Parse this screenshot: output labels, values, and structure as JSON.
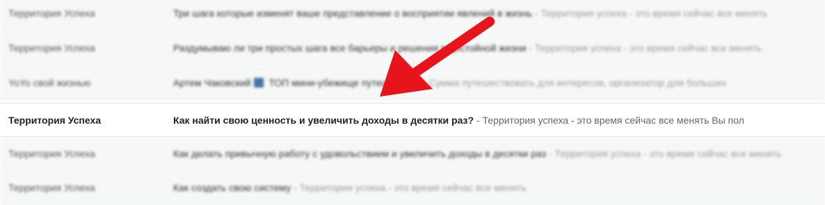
{
  "inbox": {
    "rows": [
      {
        "sender": "Территория Успеха",
        "subject": "Три шага которые изменят ваше представление о восприятии явлений в жизнь",
        "snippet": " - Территория успеха - это время сейчас все менять"
      },
      {
        "sender": "Территория Успеха",
        "subject": "Раздумываю ли три простых шага все барьеры и решения в достойной жизни",
        "snippet": " - Территория успеха - это время сейчас все менять"
      },
      {
        "sender": "YoYo свой жизнью",
        "subject": "Артем Чаковский",
        "subject_tail": " ТОП мини-убежище путешествие",
        "snippet": " - Сумма путешествовать для интересов, организатор для больших"
      },
      {
        "sender": "Территория Успеха",
        "subject": "Как найти свою ценность и увеличить доходы в десятки раз?",
        "snippet": " - Территория успеха - это время сейчас все менять Вы пол"
      },
      {
        "sender": "Территория Успеха",
        "subject": "Как делать привычную работу с удовольствием и увеличить доходы в десятки раз",
        "snippet": " - Территория успеха - это время сейчас все менять"
      },
      {
        "sender": "Территория Успеха",
        "subject": "Как создать свою систему",
        "snippet": " - Территория успеха - это время сейчас все менять"
      }
    ]
  },
  "annotation": {
    "arrow_color": "#e8141c",
    "icon": "red-arrow-icon"
  }
}
